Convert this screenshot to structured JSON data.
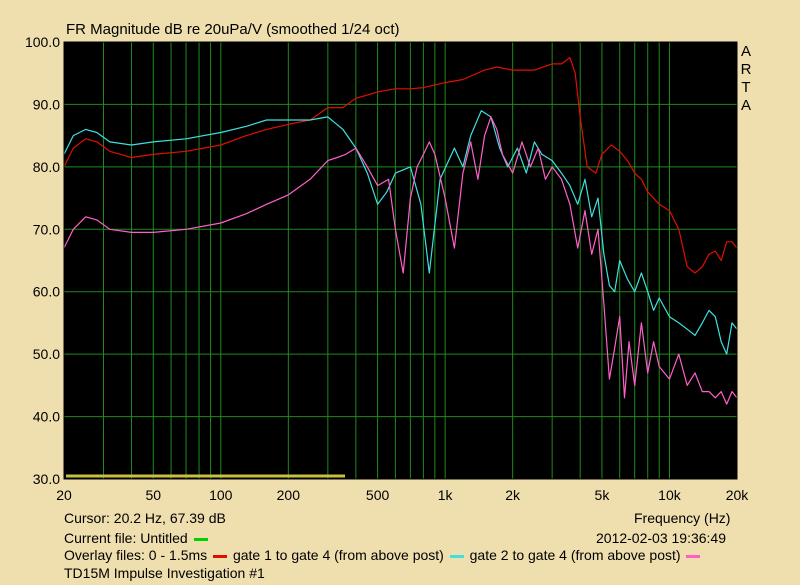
{
  "title": "FR Magnitude dB re 20uPa/V (smoothed 1/24 oct)",
  "brand": [
    "A",
    "R",
    "T",
    "A"
  ],
  "cursor_text": "Cursor: 20.2 Hz, 67.39 dB",
  "frequency_label": "Frequency (Hz)",
  "current_file_text": "Current file: Untitled",
  "datetime_text": "2012-02-03  19:36:49",
  "overlay_prefix": "Overlay files: 0 - 1.5ms",
  "overlay_items": [
    {
      "label": "gate 1 to gate 4 (from above post)",
      "color": "#ff40ff"
    }
  ],
  "overlay_middle": "gate 1 to gate 4 (from above post)",
  "overlay_last": "gate 2 to gate 4 (from above post)",
  "footer_text": "TD15M Impulse Investigation #1",
  "colors": {
    "background": "#efdfaf",
    "plot_bg": "#000000",
    "grid": "#1e8a1e",
    "current_file": "#00d000",
    "red": "#e01000",
    "cyan": "#40e0e0",
    "pink": "#ff60c8",
    "bottom_bar": "#c8c040"
  },
  "chart_data": {
    "type": "line",
    "title": "FR Magnitude dB re 20uPa/V (smoothed 1/24 oct)",
    "xlabel": "Frequency (Hz)",
    "ylabel": "",
    "xscale": "log",
    "xlim": [
      20,
      20000
    ],
    "ylim": [
      30,
      100
    ],
    "grid": true,
    "x_tick_labels": [
      "20",
      "50",
      "100",
      "200",
      "500",
      "1k",
      "2k",
      "5k",
      "10k",
      "20k"
    ],
    "x_tick_values": [
      20,
      50,
      100,
      200,
      500,
      1000,
      2000,
      5000,
      10000,
      20000
    ],
    "y_tick_labels": [
      "30.0",
      "40.0",
      "50.0",
      "60.0",
      "70.0",
      "80.0",
      "90.0",
      "100.0"
    ],
    "y_tick_values": [
      30,
      40,
      50,
      60,
      70,
      80,
      90,
      100
    ],
    "series": [
      {
        "name": "0 - 1.5ms",
        "color": "#e01000",
        "x": [
          20,
          22,
          25,
          28,
          32,
          40,
          50,
          70,
          100,
          130,
          160,
          200,
          250,
          300,
          350,
          400,
          450,
          500,
          600,
          700,
          800,
          1000,
          1200,
          1500,
          1700,
          2000,
          2500,
          3000,
          3300,
          3600,
          3800,
          4000,
          4300,
          4700,
          5000,
          5500,
          6000,
          6500,
          7000,
          7500,
          8000,
          9000,
          10000,
          11000,
          12000,
          13000,
          14000,
          15000,
          16000,
          17000,
          18000,
          19000,
          20000
        ],
        "y": [
          80,
          83,
          84.5,
          84,
          82.5,
          81.5,
          82,
          82.5,
          83.5,
          85,
          86,
          86.8,
          87.5,
          89.5,
          89.5,
          91,
          91.5,
          92,
          92.5,
          92.5,
          92.7,
          93.5,
          94,
          95.5,
          96,
          95.5,
          95.5,
          96.5,
          96.5,
          97.5,
          95,
          88,
          80,
          79,
          82,
          83.5,
          82.5,
          81,
          79,
          78,
          76,
          74,
          73,
          70,
          64,
          63,
          64,
          66,
          66.5,
          65,
          68,
          68,
          67
        ]
      },
      {
        "name": "gate 1 to gate 4 (from above post)",
        "color": "#40e0e0",
        "x": [
          20,
          22,
          25,
          28,
          32,
          40,
          50,
          70,
          100,
          130,
          160,
          200,
          250,
          300,
          350,
          400,
          450,
          500,
          550,
          600,
          700,
          780,
          850,
          950,
          1100,
          1200,
          1300,
          1450,
          1600,
          1750,
          1900,
          2100,
          2300,
          2500,
          2700,
          3000,
          3300,
          3600,
          3900,
          4200,
          4500,
          4800,
          5100,
          5400,
          5700,
          6000,
          6500,
          7000,
          7500,
          8000,
          8500,
          9000,
          10000,
          11000,
          12000,
          13000,
          14000,
          15000,
          16000,
          17000,
          18000,
          19000,
          20000
        ],
        "y": [
          82,
          85,
          86,
          85.5,
          84,
          83.5,
          84,
          84.5,
          85.5,
          86.5,
          87.5,
          87.5,
          87.5,
          88,
          86,
          83,
          79,
          74,
          76,
          79,
          80,
          74,
          63,
          78,
          83,
          80,
          85,
          89,
          88,
          83,
          80,
          83,
          79,
          84,
          82,
          81,
          79,
          77,
          74,
          78,
          72,
          75,
          66,
          61,
          60,
          65,
          62,
          60,
          63,
          60,
          57,
          59,
          56,
          55,
          54,
          53,
          55,
          57,
          56,
          52,
          50,
          55,
          54
        ]
      },
      {
        "name": "gate 2 to gate 4 (from above post)",
        "color": "#ff60c8",
        "x": [
          20,
          22,
          25,
          28,
          32,
          40,
          50,
          70,
          100,
          130,
          160,
          200,
          250,
          300,
          330,
          360,
          400,
          450,
          500,
          560,
          600,
          650,
          700,
          750,
          800,
          850,
          900,
          1000,
          1100,
          1200,
          1300,
          1400,
          1500,
          1600,
          1700,
          1800,
          2000,
          2200,
          2400,
          2600,
          2800,
          3000,
          3300,
          3600,
          3900,
          4200,
          4500,
          4800,
          5100,
          5400,
          5700,
          6000,
          6300,
          6600,
          7000,
          7500,
          8000,
          8500,
          9000,
          10000,
          11000,
          12000,
          13000,
          14000,
          15000,
          16000,
          17000,
          18000,
          19000,
          20000
        ],
        "y": [
          67,
          70,
          72,
          71.5,
          70,
          69.5,
          69.5,
          70,
          71,
          72.5,
          74,
          75.5,
          78,
          81,
          81.5,
          82,
          83,
          80,
          77,
          78,
          70,
          63,
          75,
          80,
          82,
          84,
          82,
          75,
          67,
          79,
          84,
          78,
          85,
          88,
          86,
          82,
          79,
          84,
          80,
          83,
          78,
          80,
          78,
          74,
          67,
          73,
          66,
          70,
          58,
          46,
          51,
          56,
          43,
          52,
          45,
          55,
          47,
          52,
          48,
          46,
          50,
          45,
          47,
          44,
          44,
          43,
          44,
          42,
          44,
          43
        ]
      }
    ]
  }
}
